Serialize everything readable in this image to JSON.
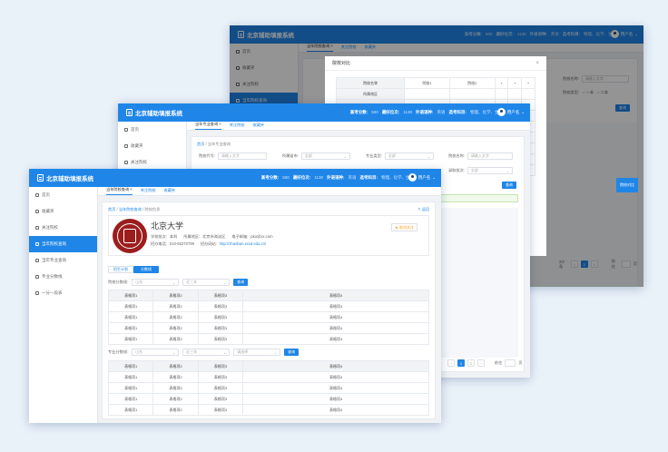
{
  "app": {
    "title": "北京辅助填报系统"
  },
  "header": {
    "score_label": "高考分数:",
    "score_value": "500",
    "rank_label": "最好位次:",
    "rank_value": "1130",
    "foreign_label": "外语语种:",
    "foreign_value": "英语",
    "subjects_label": "选考科目:",
    "subjects_value": "物理、化学、生物",
    "user_label": "用户名"
  },
  "sidebar": {
    "items": [
      {
        "label": "首页"
      },
      {
        "label": "收藏夹"
      },
      {
        "label": "关注院校"
      },
      {
        "label": "当年院校查询"
      },
      {
        "label": "当年专业查询"
      },
      {
        "label": "专业分数线"
      },
      {
        "label": "一分一段表"
      }
    ]
  },
  "front": {
    "tabs": [
      "当年院校查询 ×",
      "关注院校",
      "收藏夹"
    ],
    "breadcrumb": {
      "home": "首页",
      "parent": "当年院校查询",
      "current": "院校信息"
    },
    "back_label": "↰ 返回",
    "school": {
      "name": "北京大学",
      "batch_label": "学校批次:",
      "batch": "本科",
      "region_label": "所属地区:",
      "region": "北京市海淀区",
      "email_label": "电子邮箱:",
      "email": "pku@xx.com",
      "phone_label": "招办电话:",
      "phone": "010-55270799",
      "site_label": "招办网站:",
      "site": "http://zhaoban.xxxd.edu.cn/",
      "follow_label": "★ 取消关注"
    },
    "subtabs": [
      "招生计划",
      "分数线"
    ],
    "filter1": {
      "label": "院校分数线:",
      "province": "山东",
      "year": "近三年",
      "button": "查询"
    },
    "filter2": {
      "label": "专业分数线:",
      "province": "山东",
      "year": "近三年",
      "third": "请选择",
      "button": "查询"
    },
    "table_headers": [
      "表格项1",
      "表格项2",
      "表格项3",
      "表格项4"
    ],
    "table1_rows": [
      [
        "表格项1",
        "表格项2",
        "表格项3",
        "表格项4"
      ],
      [
        "表格项1",
        "表格项2",
        "表格项3",
        "表格项4"
      ],
      [
        "表格项1",
        "表格项2",
        "表格项3",
        "表格项4"
      ],
      [
        "表格项1",
        "表格项2",
        "表格项3",
        "表格项4"
      ]
    ],
    "table2_rows": [
      [
        "表格项1",
        "表格项2",
        "表格项3",
        "表格项4"
      ],
      [
        "表格项1",
        "表格项2",
        "表格项3",
        "表格项4"
      ],
      [
        "表格项1",
        "表格项2",
        "表格项3",
        "表格项4"
      ],
      [
        "表格项1",
        "表格项2",
        "表格项3",
        "表格项4"
      ]
    ]
  },
  "middle": {
    "tabs": [
      "当年专业查询 ×",
      "关注院校",
      "收藏夹"
    ],
    "breadcrumb": {
      "home": "首页",
      "current": "当年专业查询"
    },
    "code_label": "院校代号:",
    "code_placeholder": "请输入文字",
    "province_label": "所属省市:",
    "province_value": "全部",
    "category_label": "专业类型:",
    "category_value": "全部",
    "name_label": "院校名称:",
    "name_placeholder": "请输入文字",
    "batch_label": "录取批次:",
    "batch_value": "全部",
    "search_button": "查询",
    "pagination": {
      "prev": "‹",
      "pages": [
        "1",
        "2"
      ],
      "next": "›",
      "goto_label": "前往",
      "page_unit": "页"
    }
  },
  "back": {
    "tabs": [
      "当年院校查询 ×",
      "关注院校",
      "收藏夹"
    ],
    "name_label": "院校名称:",
    "name_placeholder": "请输入文字",
    "type_label": "院校类型:",
    "type_options": [
      "一本",
      "二本"
    ],
    "search_button": "查询",
    "compare_label": "院校对比",
    "page_size_label": "20/条 ",
    "pages": [
      "1",
      "2",
      "3"
    ],
    "goto_label": "前往",
    "page_unit": "页",
    "modal": {
      "title": "院校对比",
      "close": "×",
      "headers": [
        "院校名称",
        "院校1",
        "院校2",
        "+",
        "+",
        "+"
      ],
      "row_label": "所属地区"
    }
  }
}
